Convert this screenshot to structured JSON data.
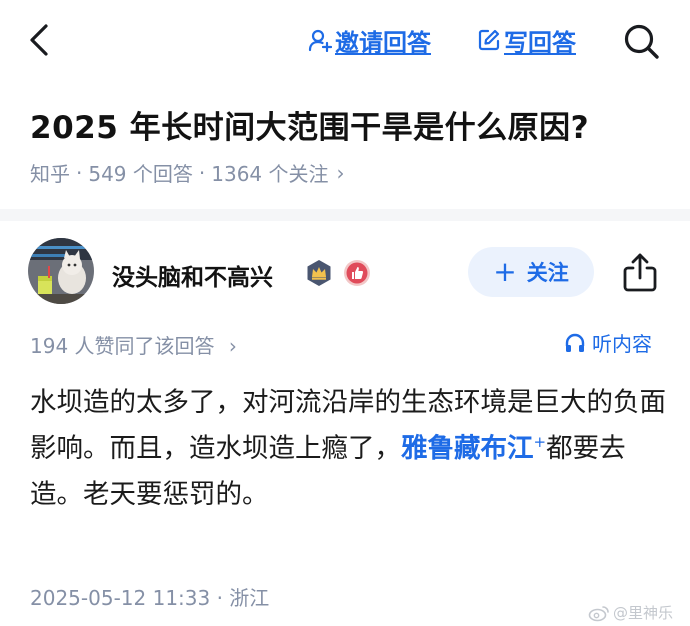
{
  "topbar": {
    "back_icon": "back-chevron-icon",
    "invite_label": "邀请回答",
    "invite_icon": "invite-person-icon",
    "write_label": "写回答",
    "write_icon": "edit-pencil-icon",
    "search_icon": "search-icon",
    "accent_color": "#1e6be6"
  },
  "question": {
    "title": "2025 年长时间大范围干旱是什么原因?",
    "source": "知乎",
    "answers_count": "549 个回答",
    "followers_count": "1364 个关注",
    "chevron": "›"
  },
  "author": {
    "name": "没头脑和不高兴",
    "avatar_icon": "avatar-cat-photo",
    "badges": [
      "crown-badge-icon",
      "thumbs-up-badge-icon"
    ],
    "follow_label": "关注",
    "follow_plus": "+",
    "share_icon": "share-icon"
  },
  "answer_meta": {
    "likes_text": "194 人赞同了该回答",
    "chevron": "›",
    "listen_label": "听内容",
    "listen_icon": "headphones-icon"
  },
  "answer": {
    "text_before_link": "水坝造的太多了，对河流沿岸的生态环境是巨大的负面影响。而且，造水坝造上瘾了，",
    "link_text": "雅鲁藏布江",
    "link_marker": "+",
    "text_after_link": "都要去造。老天要惩罚的。"
  },
  "footer": {
    "timestamp_location": "2025-05-12 11:33 · 浙江",
    "watermark": "@里神乐"
  }
}
